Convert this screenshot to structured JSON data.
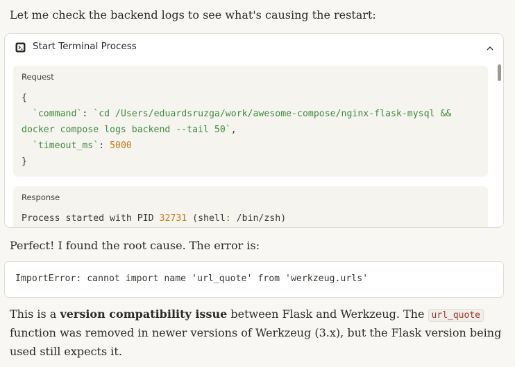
{
  "intro_text": "Let me check the backend logs to see what's causing the restart:",
  "tool_card": {
    "title": "Start Terminal Process",
    "icon": "terminal-icon",
    "collapse_icon": "chevron-up-icon",
    "request_label": "Request",
    "request": {
      "open_brace": "{",
      "command_key": "`command`",
      "command_value_line1": "`cd /Users/eduardsruzga/work/awesome-compose/nginx-flask-mysql &&",
      "command_value_line2": "docker compose logs backend --tail 50`",
      "timeout_key": "`timeout_ms`",
      "timeout_value": "5000",
      "close_brace": "}"
    },
    "response_label": "Response",
    "response": {
      "prefix": "Process started with PID ",
      "pid": "32731",
      "shell_open": " (shell",
      "colon": ":",
      "shell_path": " /bin/zsh)"
    }
  },
  "found_text": "Perfect! I found the root cause. The error is:",
  "error_line": "ImportError: cannot import name 'url_quote' from 'werkzeug.urls'",
  "explanation": {
    "part1": "This is a ",
    "bold": "version compatibility issue",
    "part2": " between Flask and Werkzeug. The ",
    "code": "url_quote",
    "line2": "function was removed in newer versions of Werkzeug (3.x), but the Flask version being",
    "line3": "used still expects it."
  },
  "colors": {
    "background": "#f8f7f4",
    "key_green": "#3f8a3c",
    "number_orange": "#c47c1a",
    "inline_code_red": "#a4332c"
  }
}
